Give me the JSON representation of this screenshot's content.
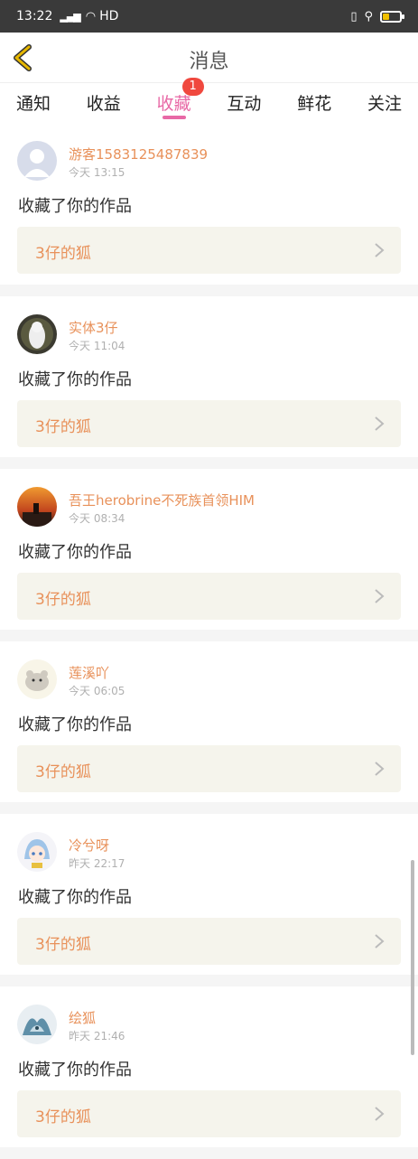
{
  "status": {
    "time": "13:22",
    "network": "HD"
  },
  "header": {
    "title": "消息"
  },
  "tabs": [
    {
      "label": "通知"
    },
    {
      "label": "收益"
    },
    {
      "label": "收藏",
      "badge": "1",
      "active": true
    },
    {
      "label": "互动"
    },
    {
      "label": "鲜花"
    },
    {
      "label": "关注"
    }
  ],
  "messages": [
    {
      "user": "游客1583125487839",
      "time": "今天 13:15",
      "action": "收藏了你的作品",
      "work": "3仔的狐",
      "avatar": "default-avatar-icon"
    },
    {
      "user": "实体3仔",
      "time": "今天 11:04",
      "action": "收藏了你的作品",
      "work": "3仔的狐",
      "avatar": "white-fox-photo-avatar"
    },
    {
      "user": "吾王herobrine不死族首领HIM",
      "time": "今天 08:34",
      "action": "收藏了你的作品",
      "work": "3仔的狐",
      "avatar": "sunset-scene-avatar"
    },
    {
      "user": "莲溪吖",
      "time": "今天 06:05",
      "action": "收藏了你的作品",
      "work": "3仔的狐",
      "avatar": "hamster-avatar"
    },
    {
      "user": "冷兮呀",
      "time": "昨天 22:17",
      "action": "收藏了你的作品",
      "work": "3仔的狐",
      "avatar": "anime-girl-avatar"
    },
    {
      "user": "绘狐",
      "time": "昨天 21:46",
      "action": "收藏了你的作品",
      "work": "3仔的狐",
      "avatar": "blue-fox-avatar"
    }
  ],
  "colors": {
    "accent": "#e869a6",
    "username": "#e8915a",
    "badge": "#f0483e",
    "back_arrow": "#e6b700"
  }
}
